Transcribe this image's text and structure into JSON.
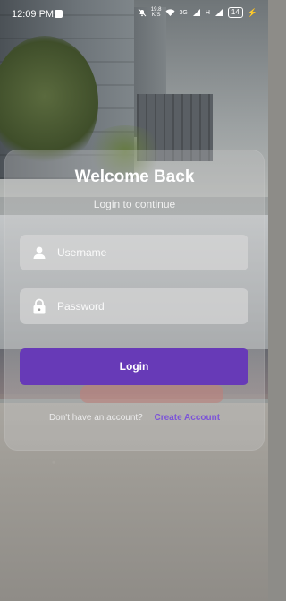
{
  "status_bar": {
    "time": "12:09 PM",
    "speed_top": "19.8",
    "speed_bottom": "K/S",
    "network_3g": "3G",
    "network_h": "H",
    "battery": "14"
  },
  "login": {
    "title": "Welcome Back",
    "subtitle": "Login to continue",
    "username_placeholder": "Username",
    "password_placeholder": "Password",
    "login_button": "Login",
    "no_account_text": "Don't have an account?",
    "create_account_link": "Create Account"
  },
  "colors": {
    "primary": "#673ab7",
    "link": "#7c54d8"
  },
  "icons": {
    "username": "person-icon",
    "password": "lock-icon"
  }
}
